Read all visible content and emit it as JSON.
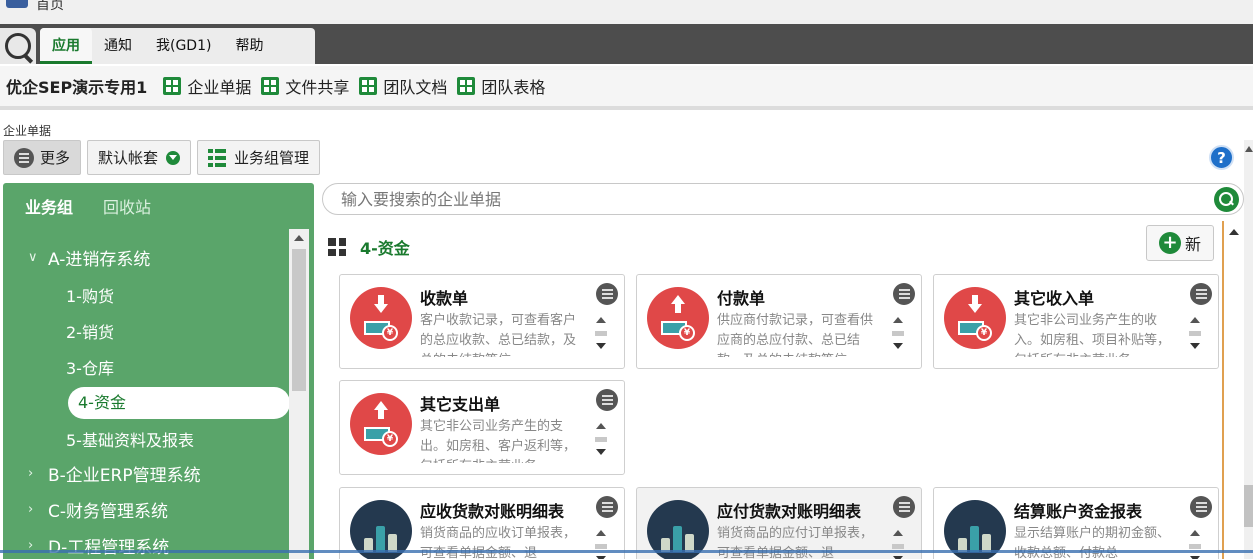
{
  "window": {
    "title": "首页"
  },
  "menu": {
    "tabs": [
      {
        "label": "应用"
      },
      {
        "label": "通知"
      },
      {
        "label": "我(GD1)"
      },
      {
        "label": "帮助"
      }
    ]
  },
  "toolbar": {
    "company": "优企SEP演示专用1",
    "links": [
      {
        "label": "企业单据"
      },
      {
        "label": "文件共享"
      },
      {
        "label": "团队文档"
      },
      {
        "label": "团队表格"
      }
    ]
  },
  "section_label": "企业单据",
  "buttons": {
    "more": "更多",
    "account_set": "默认帐套",
    "group_manage": "业务组管理",
    "help": "?"
  },
  "sidebar": {
    "tabs": [
      {
        "label": "业务组"
      },
      {
        "label": "回收站"
      }
    ],
    "tree": [
      {
        "label": "A-进销存系统"
      },
      {
        "label": "1-购货"
      },
      {
        "label": "2-销货"
      },
      {
        "label": "3-仓库"
      },
      {
        "label": "4-资金"
      },
      {
        "label": "5-基础资料及报表"
      },
      {
        "label": "B-企业ERP管理系统"
      },
      {
        "label": "C-财务管理系统"
      },
      {
        "label": "D-工程管理系统"
      }
    ]
  },
  "search": {
    "placeholder": "输入要搜索的企业单据"
  },
  "content": {
    "heading": "4-资金",
    "new_label": "新",
    "cards": [
      {
        "name": "收款单",
        "desc": "客户收款记录，可查看客户的总应收款、总已结款，及总的未结款等信"
      },
      {
        "name": "付款单",
        "desc": "供应商付款记录，可查看供应商的总应付款、总已结款，及总的未结款等信"
      },
      {
        "name": "其它收入单",
        "desc": "其它非公司业务产生的收入。如房租、项目补贴等，包括所有非主营业务"
      },
      {
        "name": "其它支出单",
        "desc": "其它非公司业务产生的支出。如房租、客户返利等，包括所有非主营业务"
      },
      {
        "name": "应收货款对账明细表",
        "desc": "销货商品的应收订单报表，可查看单据金额、退"
      },
      {
        "name": "应付货款对账明细表",
        "desc": "销货商品的应付订单报表，可查看单据金额、退"
      },
      {
        "name": "结算账户资金报表",
        "desc": "显示结算账户的期初金额、收款总额、付款总"
      }
    ]
  }
}
